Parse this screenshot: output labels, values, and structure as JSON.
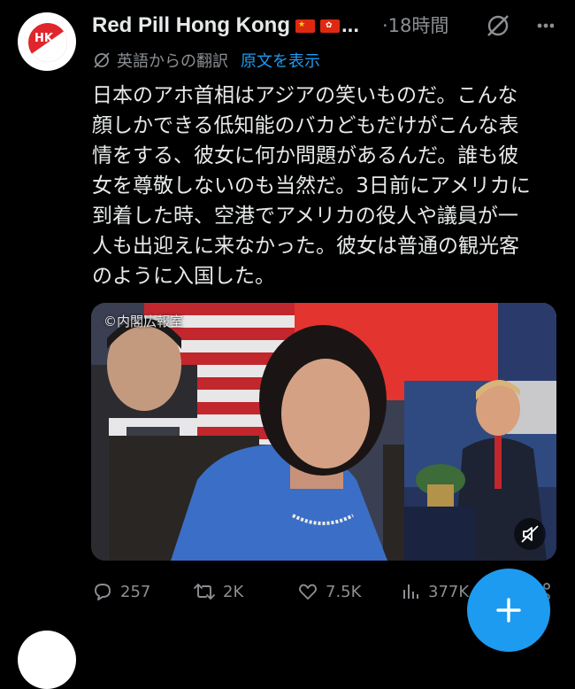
{
  "tweet": {
    "author_name": "Red Pill Hong Kong",
    "flags": [
      "China flag",
      "Hong Kong flag"
    ],
    "truncation": "...",
    "time": "·18時間",
    "avatar_text": "HK",
    "translation_label": "英語からの翻訳",
    "show_original": "原文を表示",
    "lines": [
      "日本のアホ首相はアジアの笑いものだ。こんな",
      "顔しかできる低知能のバカどもだけがこんな表",
      "情をする、彼女に何か問題があるんだ。誰も彼",
      "女を尊敬しないのも当然だ。3日前にアメリカに",
      "到着した時、空港でアメリカの役人や議員が一",
      "人も出迎えに来なかった。彼女は普通の観光客",
      "のように入国した。"
    ],
    "media": {
      "copyright": "©内閣広報室",
      "muted": true
    },
    "stats": {
      "replies": "257",
      "reposts": "2K",
      "likes": "7.5K",
      "views": "377K"
    }
  },
  "colors": {
    "background": "#000000",
    "text": "#e7e9ea",
    "secondary": "#8b8f93",
    "accent": "#1d9bf0"
  },
  "icons": [
    "grok-icon",
    "more-icon",
    "translate-icon",
    "reply-icon",
    "repost-icon",
    "like-icon",
    "views-icon",
    "share-icon",
    "mute-icon",
    "plus-icon"
  ]
}
